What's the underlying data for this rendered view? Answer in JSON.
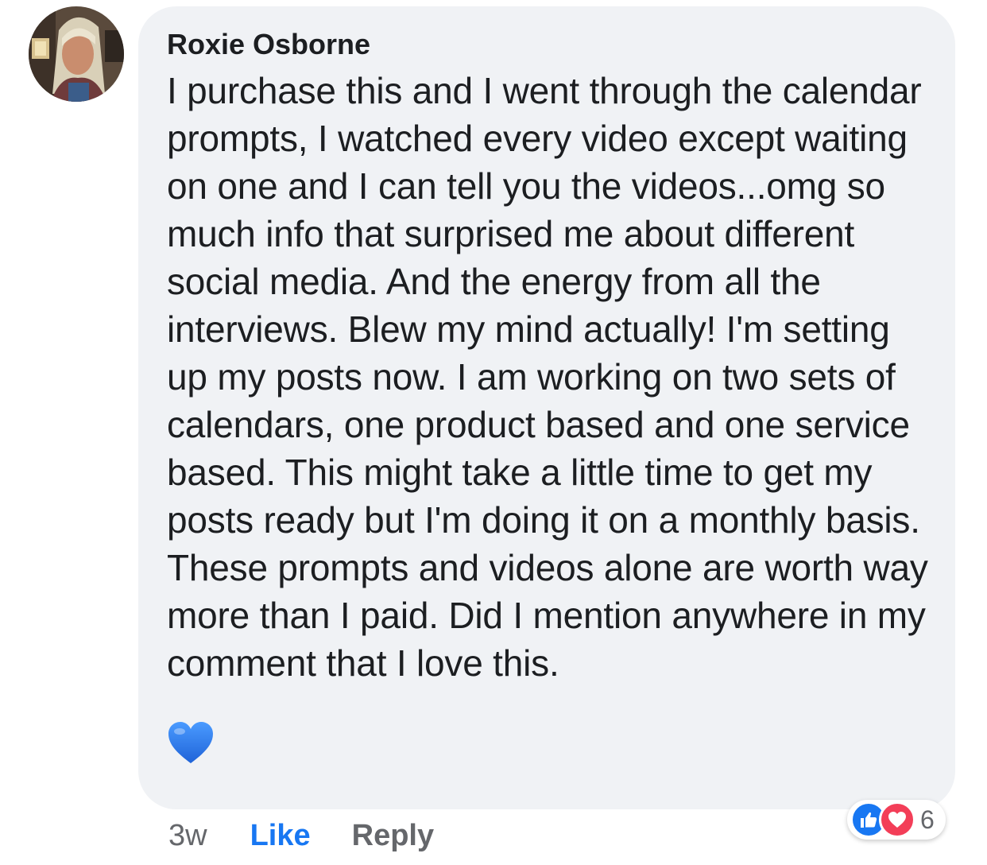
{
  "comment": {
    "author": "Roxie Osborne",
    "text": "I purchase this and I went through the calendar prompts, I watched every video except waiting on one and I can tell you the videos...omg so much info that surprised me about different social media. And the energy from all the interviews. Blew my mind actually! I'm setting up my posts now. I am working on two sets of calendars, one product based and one service based. This might take a little time to get my posts ready but I'm doing it on a monthly basis. These prompts and videos alone are worth way more than I paid. Did I mention anywhere in my comment that I love this.",
    "emoji": "blue-heart-icon"
  },
  "actions": {
    "time": "3w",
    "like_label": "Like",
    "reply_label": "Reply"
  },
  "reactions": {
    "types": [
      "like-icon",
      "love-icon"
    ],
    "count": "6"
  },
  "colors": {
    "bubble": "#f0f2f5",
    "like_blue": "#1877f2",
    "love_red": "#f33e58",
    "heart_blue": "#2f7ef0"
  }
}
